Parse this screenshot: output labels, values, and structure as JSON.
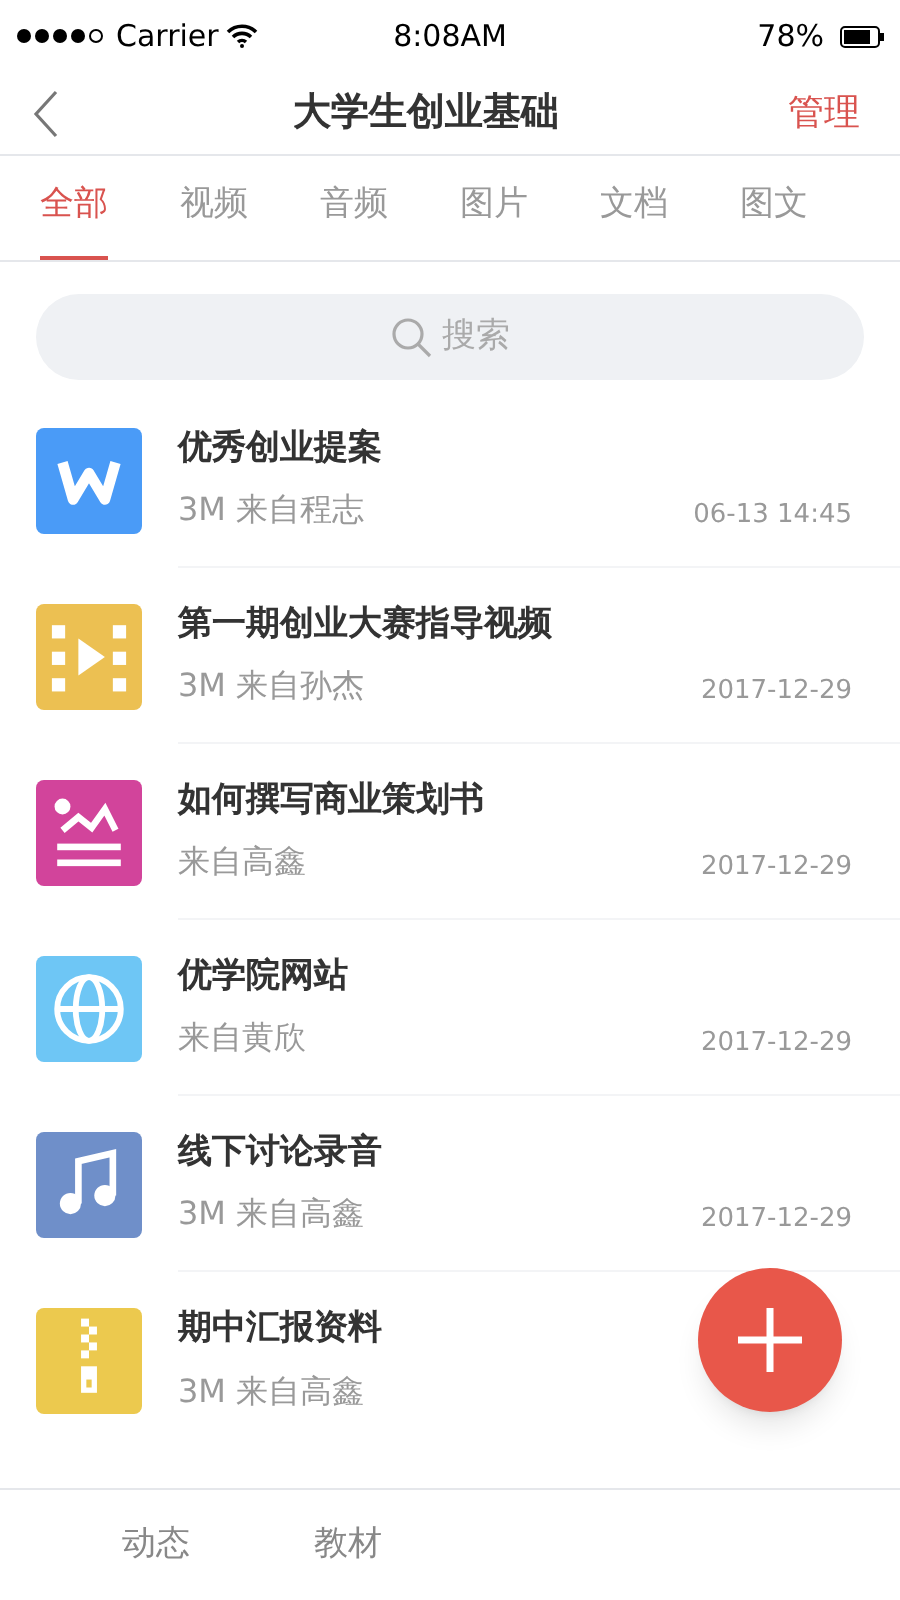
{
  "status_bar": {
    "carrier": "Carrier",
    "time": "8:08AM",
    "battery": "78%"
  },
  "nav": {
    "title": "大学生创业基础",
    "action": "管理"
  },
  "tabs": [
    {
      "label": "全部",
      "selected": true
    },
    {
      "label": "视频",
      "selected": false
    },
    {
      "label": "音频",
      "selected": false
    },
    {
      "label": "图片",
      "selected": false
    },
    {
      "label": "文档",
      "selected": false
    },
    {
      "label": "图文",
      "selected": false
    }
  ],
  "search": {
    "placeholder": "搜索"
  },
  "files": [
    {
      "kind": "document",
      "title": "优秀创业提案",
      "meta": "3M 来自程志",
      "date": "06-13 14:45"
    },
    {
      "kind": "video",
      "title": "第一期创业大赛指导视频",
      "meta": "3M 来自孙杰",
      "date": "2017-12-29"
    },
    {
      "kind": "image",
      "title": "如何撰写商业策划书",
      "meta": "来自高鑫",
      "date": "2017-12-29"
    },
    {
      "kind": "link",
      "title": "优学院网站",
      "meta": "来自黄欣",
      "date": "2017-12-29"
    },
    {
      "kind": "audio",
      "title": "线下讨论录音",
      "meta": "3M 来自高鑫",
      "date": "2017-12-29"
    },
    {
      "kind": "archive",
      "title": "期中汇报资料",
      "meta": "3M 来自高鑫"
    }
  ],
  "bottom_tabs": [
    {
      "label": "动态"
    },
    {
      "label": "教材"
    }
  ]
}
